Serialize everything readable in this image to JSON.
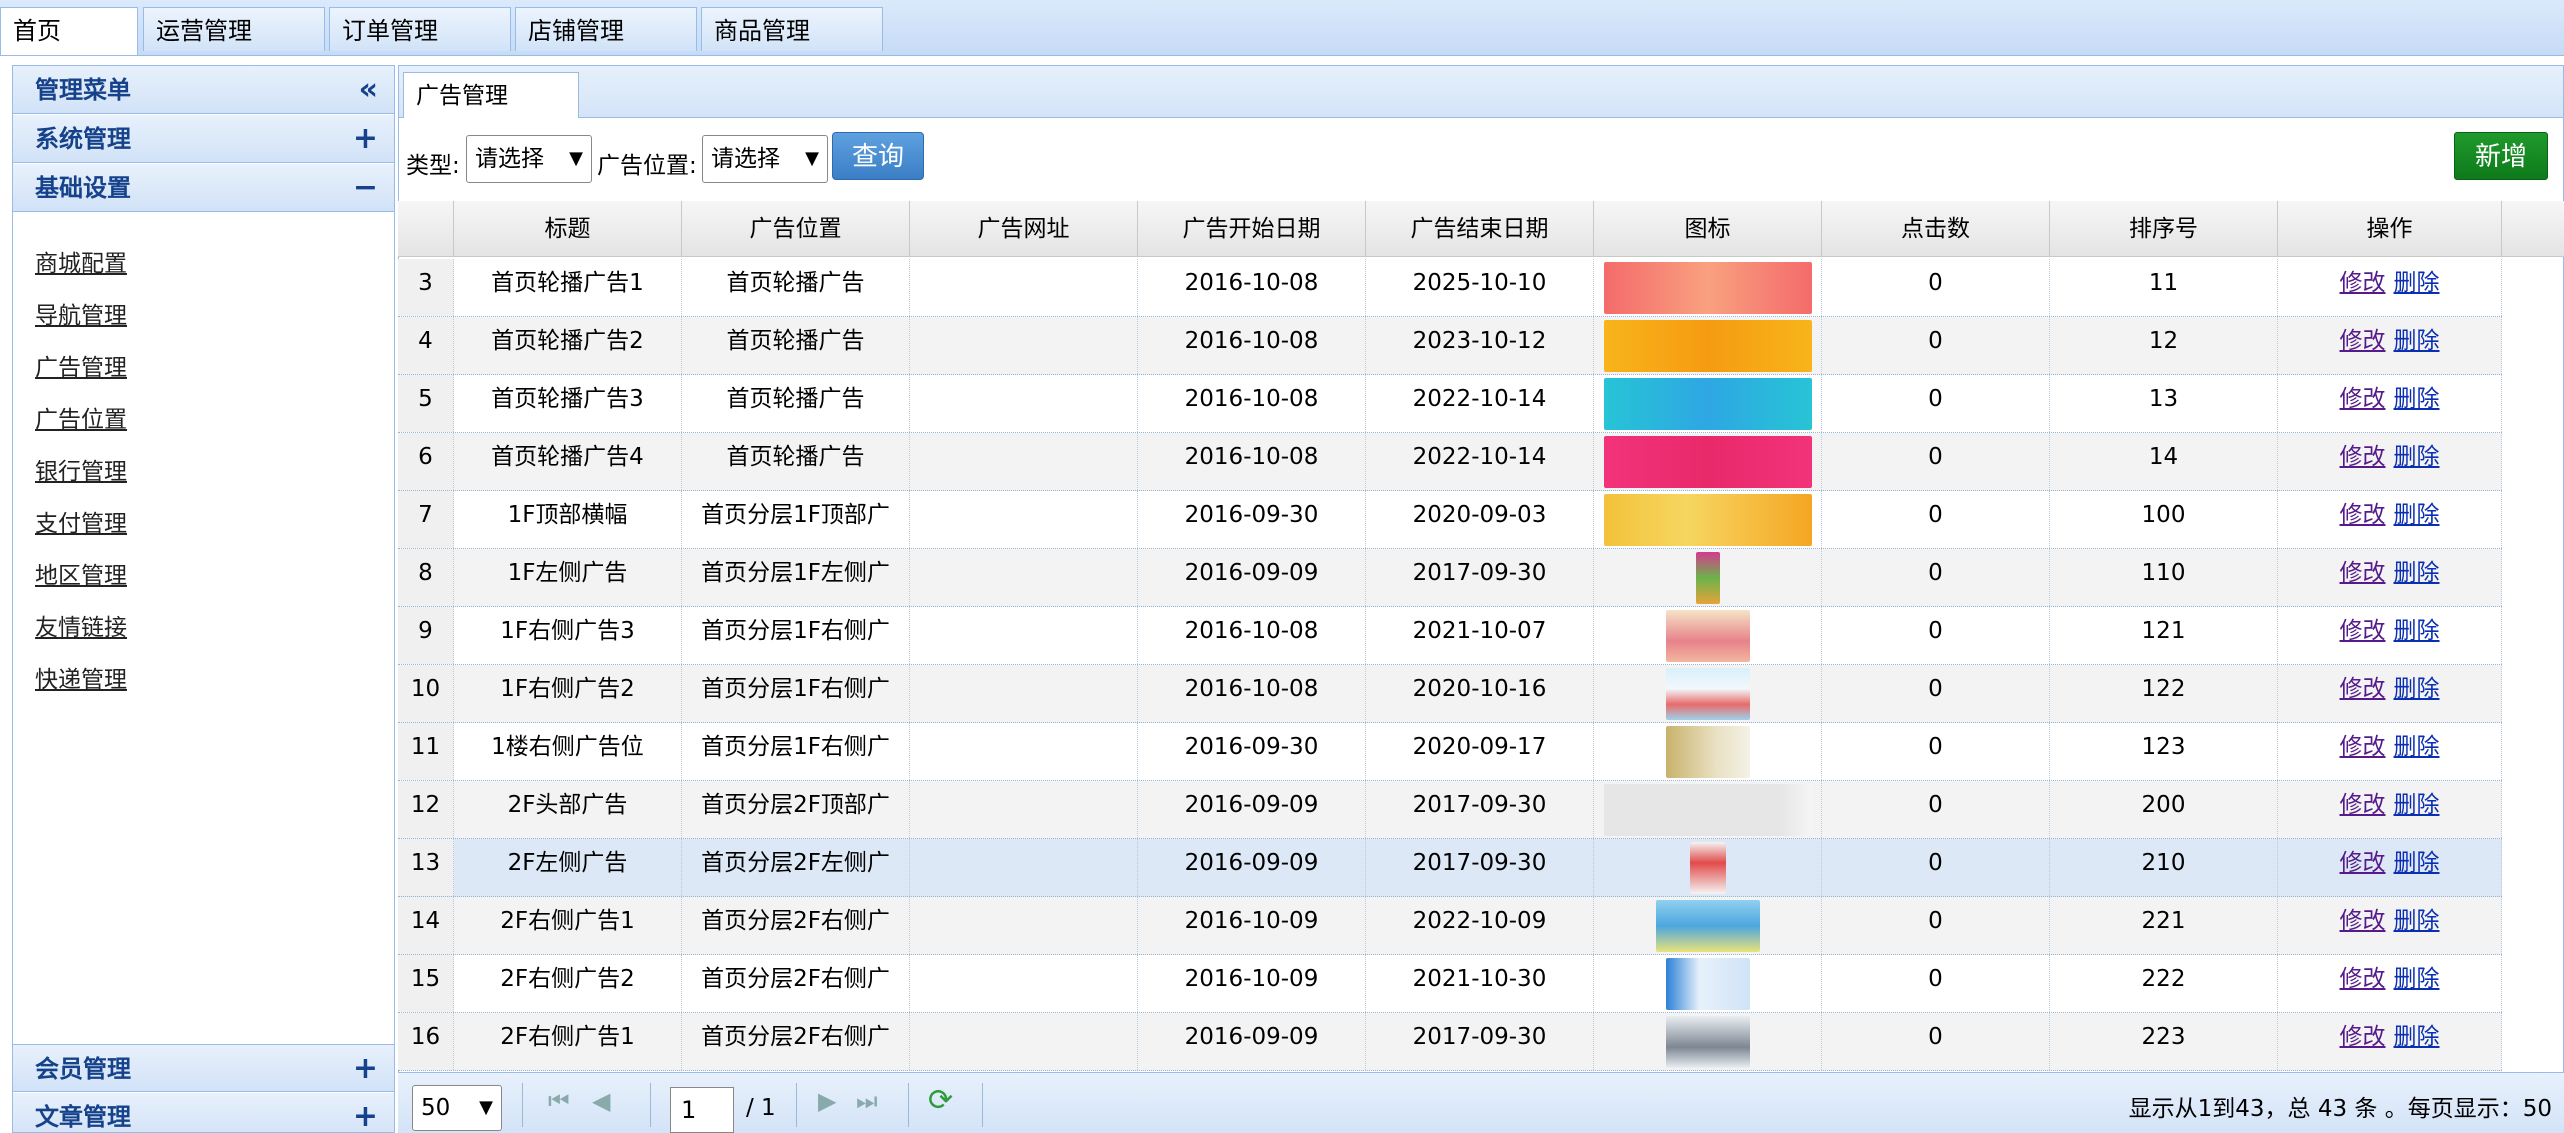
{
  "top_tabs": [
    "首页",
    "运营管理",
    "订单管理",
    "店铺管理",
    "商品管理"
  ],
  "sidebar": {
    "title": "管理菜单",
    "title_sign": "«",
    "groups": [
      {
        "label": "系统管理",
        "sign": "+"
      },
      {
        "label": "基础设置",
        "sign": "−"
      },
      {
        "label": "会员管理",
        "sign": "+"
      },
      {
        "label": "文章管理",
        "sign": "+"
      }
    ],
    "links": [
      "商城配置",
      "导航管理",
      "广告管理",
      "广告位置",
      "银行管理",
      "支付管理",
      "地区管理",
      "友情链接",
      "快递管理"
    ]
  },
  "main_tab": "广告管理",
  "toolbar": {
    "type_label": "类型:",
    "type_value": "请选择",
    "position_label": "广告位置:",
    "position_value": "请选择",
    "query_button": "查询",
    "add_button": "新增"
  },
  "grid": {
    "columns": [
      "标题",
      "广告位置",
      "广告网址",
      "广告开始日期",
      "广告结束日期",
      "图标",
      "点击数",
      "排序号",
      "操作"
    ],
    "edit_label": "修改",
    "delete_label": "删除",
    "rows": [
      {
        "num": "3",
        "title": "首页轮播广告1",
        "position": "首页轮播广告",
        "url": "",
        "start": "2016-10-08",
        "end": "2025-10-10",
        "clicks": "0",
        "order": "11",
        "thumb": "banner-red"
      },
      {
        "num": "4",
        "title": "首页轮播广告2",
        "position": "首页轮播广告",
        "url": "",
        "start": "2016-10-08",
        "end": "2023-10-12",
        "clicks": "0",
        "order": "12",
        "thumb": "banner-orange"
      },
      {
        "num": "5",
        "title": "首页轮播广告3",
        "position": "首页轮播广告",
        "url": "",
        "start": "2016-10-08",
        "end": "2022-10-14",
        "clicks": "0",
        "order": "13",
        "thumb": "banner-cyan"
      },
      {
        "num": "6",
        "title": "首页轮播广告4",
        "position": "首页轮播广告",
        "url": "",
        "start": "2016-10-08",
        "end": "2022-10-14",
        "clicks": "0",
        "order": "14",
        "thumb": "banner-pink"
      },
      {
        "num": "7",
        "title": "1F顶部横幅",
        "position": "首页分层1F顶部广",
        "url": "",
        "start": "2016-09-30",
        "end": "2020-09-03",
        "clicks": "0",
        "order": "100",
        "thumb": "banner-kiwi"
      },
      {
        "num": "8",
        "title": "1F左侧广告",
        "position": "首页分层1F左侧广",
        "url": "",
        "start": "2016-09-09",
        "end": "2017-09-30",
        "clicks": "0",
        "order": "110",
        "thumb": "tall-strip"
      },
      {
        "num": "9",
        "title": "1F右侧广告3",
        "position": "首页分层1F右侧广",
        "url": "",
        "start": "2016-10-08",
        "end": "2021-10-07",
        "clicks": "0",
        "order": "121",
        "thumb": "small-meat"
      },
      {
        "num": "10",
        "title": "1F右侧广告2",
        "position": "首页分层1F右侧广",
        "url": "",
        "start": "2016-10-08",
        "end": "2020-10-16",
        "clicks": "0",
        "order": "122",
        "thumb": "small-seafood"
      },
      {
        "num": "11",
        "title": "1楼右侧广告位",
        "position": "首页分层1F右侧广",
        "url": "",
        "start": "2016-09-30",
        "end": "2020-09-17",
        "clicks": "0",
        "order": "123",
        "thumb": "small-kiwi"
      },
      {
        "num": "12",
        "title": "2F头部广告",
        "position": "首页分层2F顶部广",
        "url": "",
        "start": "2016-09-09",
        "end": "2017-09-30",
        "clicks": "0",
        "order": "200",
        "thumb": "broken"
      },
      {
        "num": "13",
        "title": "2F左侧广告",
        "position": "首页分层2F左侧广",
        "url": "",
        "start": "2016-09-09",
        "end": "2017-09-30",
        "clicks": "0",
        "order": "210",
        "thumb": "small-poster"
      },
      {
        "num": "14",
        "title": "2F右侧广告1",
        "position": "首页分层2F右侧广",
        "url": "",
        "start": "2016-10-09",
        "end": "2022-10-09",
        "clicks": "0",
        "order": "221",
        "thumb": "small-kitchen"
      },
      {
        "num": "15",
        "title": "2F右侧广告2",
        "position": "首页分层2F右侧广",
        "url": "",
        "start": "2016-10-09",
        "end": "2021-10-30",
        "clicks": "0",
        "order": "222",
        "thumb": "small-blue"
      },
      {
        "num": "16",
        "title": "2F右侧广告1",
        "position": "首页分层2F右侧广",
        "url": "",
        "start": "2016-09-09",
        "end": "2017-09-30",
        "clicks": "0",
        "order": "223",
        "thumb": "small-pots"
      }
    ]
  },
  "pager": {
    "page_size": "50",
    "current_page": "1",
    "total_pages": "/ 1",
    "summary": "显示从1到43，总 43 条 。每页显示：50",
    "icons": [
      "first-page-icon",
      "prev-page-icon",
      "next-page-icon",
      "last-page-icon",
      "refresh-icon"
    ]
  },
  "colors": {
    "accent_blue": "#3a7ec6",
    "add_green": "#0e7a1b",
    "header_blue": "#15428b",
    "selected_row": "#dde8f6"
  }
}
